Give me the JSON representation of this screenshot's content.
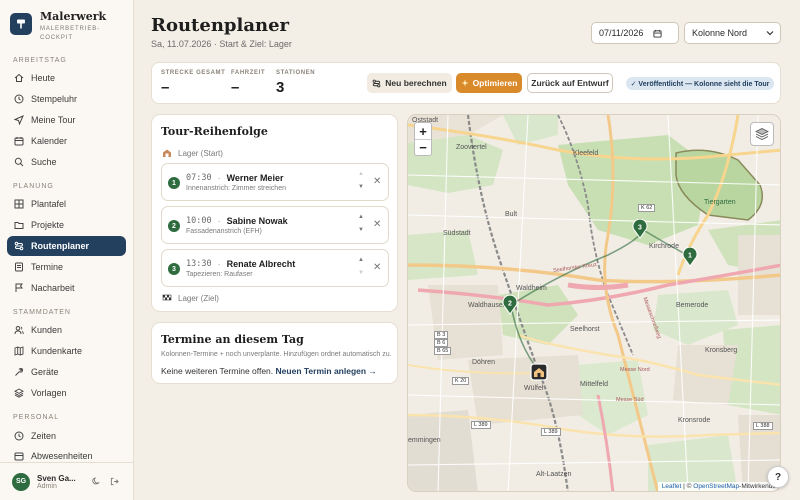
{
  "app": {
    "name": "Malerwerk",
    "subtitle": "MALERBETRIEB-COCKPIT"
  },
  "sidebar": {
    "sections": [
      {
        "title": "ARBEITSTAG"
      },
      {
        "title": "PLANUNG"
      },
      {
        "title": "STAMMDATEN"
      },
      {
        "title": "PERSONAL"
      }
    ],
    "items": [
      {
        "label": "Heute",
        "icon": "home-icon"
      },
      {
        "label": "Stempeluhr",
        "icon": "clock-icon"
      },
      {
        "label": "Meine Tour",
        "icon": "send-icon"
      },
      {
        "label": "Kalender",
        "icon": "calendar-icon"
      },
      {
        "label": "Suche",
        "icon": "search-icon"
      },
      {
        "label": "Plantafel",
        "icon": "grid-icon"
      },
      {
        "label": "Projekte",
        "icon": "folder-icon"
      },
      {
        "label": "Routenplaner",
        "icon": "route-icon"
      },
      {
        "label": "Termine",
        "icon": "list-icon"
      },
      {
        "label": "Nacharbeit",
        "icon": "flag-icon"
      },
      {
        "label": "Kunden",
        "icon": "users-icon"
      },
      {
        "label": "Kundenkarte",
        "icon": "map-icon"
      },
      {
        "label": "Geräte",
        "icon": "tool-icon"
      },
      {
        "label": "Vorlagen",
        "icon": "layers-icon"
      },
      {
        "label": "Zeiten",
        "icon": "clock-icon"
      },
      {
        "label": "Abwesenheiten",
        "icon": "calendar-off-icon"
      }
    ],
    "active": "Routenplaner",
    "user": {
      "initials": "SG",
      "name": "Sven Ga...",
      "role": "Admin"
    }
  },
  "header": {
    "title": "Routenplaner",
    "subtitle": "Sa, 11.07.2026 · Start & Ziel: Lager",
    "date_value": "07/11/2026",
    "crew_value": "Kolonne Nord"
  },
  "stats": {
    "distance_label": "STRECKE GESAMT",
    "distance_value": "–",
    "duration_label": "FAHRZEIT",
    "duration_value": "–",
    "stations_label": "STATIONEN",
    "stations_value": "3",
    "recalc_label": "Neu berechnen",
    "optimize_label": "Optimieren",
    "back_label": "Zurück auf Entwurf",
    "published_label": "✓ Veröffentlicht — Kolonne sieht die Tour"
  },
  "tour": {
    "title": "Tour-Reihenfolge",
    "start_label": "Lager (Start)",
    "end_label": "Lager (Ziel)",
    "stops": [
      {
        "num": "1",
        "time": "07:30",
        "name": "Werner Meier",
        "desc": "Innenanstrich: Zimmer streichen"
      },
      {
        "num": "2",
        "time": "10:00",
        "name": "Sabine Nowak",
        "desc": "Fassadenanstrich (EFH)"
      },
      {
        "num": "3",
        "time": "13:30",
        "name": "Renate Albrecht",
        "desc": "Tapezieren: Raufaser"
      }
    ]
  },
  "appointments": {
    "title": "Termine an diesem Tag",
    "subtitle": "Kolonnen-Termine + noch unverplante. Hinzufügen ordnet automatisch zu.",
    "none_text": "Keine weiteren Termine offen.",
    "new_link": "Neuen Termin anlegen →"
  },
  "map": {
    "zoom_in": "+",
    "zoom_out": "−",
    "labels": {
      "oststadt": "Oststadt",
      "zooviertel": "Zooviertel",
      "kleefeld": "Kleefeld",
      "tiergarten": "Tiergarten",
      "suedstadt": "Südstadt",
      "bult": "Bult",
      "kirchrode": "Kirchrode",
      "waldheim": "Waldheim",
      "waldhausen": "Waldhausen",
      "bemerode": "Bemerode",
      "seelhorst": "Seelhorst",
      "doehren": "Döhren",
      "kronsberg": "Kronsberg",
      "wuelfel": "Wülfel",
      "mittelfeld": "Mittelfeld",
      "emmingen": "emmingen",
      "kronsrode": "Kronsrode",
      "altlaatzen": "Alt-Laatzen",
      "seelhorster_kreuz": "Seelhorster Kreuz",
      "messe_nord": "Messe Nord",
      "messe_sued": "Messe Süd",
      "messeschnellweg": "Messeschnellweg"
    },
    "road_badges": {
      "k62": "K 62",
      "b3": "B 3",
      "b6": "B 6",
      "b65": "B 65",
      "k20": "K 20",
      "l389": "L 389",
      "l388": "L 388",
      "l389b": "L 389"
    },
    "pins": [
      "1",
      "2",
      "3"
    ],
    "attribution_leaflet": "Leaflet",
    "attribution_sep": "| ©",
    "attribution_osm": "OpenStreetMap",
    "attribution_rest": "-Mitwirkende"
  },
  "help_label": "?",
  "colors": {
    "primary": "#23405f",
    "accent": "#d98a2b",
    "success": "#2e6b3e",
    "background": "#f4efe6"
  }
}
